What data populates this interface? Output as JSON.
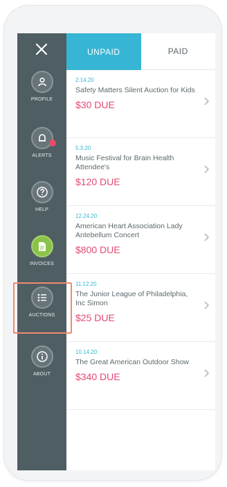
{
  "sidebar": {
    "close_glyph": "✕",
    "items": [
      {
        "label": "PROFILE",
        "icon": "person-icon"
      },
      {
        "label": "ALERTS",
        "icon": "bell-icon"
      },
      {
        "label": "HELP",
        "icon": "question-icon"
      },
      {
        "label": "INVOICES",
        "icon": "document-icon"
      },
      {
        "label": "AUCTIONS",
        "icon": "list-icon"
      },
      {
        "label": "ABOUT",
        "icon": "info-icon"
      }
    ]
  },
  "tabs": [
    {
      "label": "UNPAID",
      "active": true
    },
    {
      "label": "PAID",
      "active": false
    }
  ],
  "invoices": [
    {
      "date": "2.14.20",
      "title": "Safety Matters Silent Auction for Kids",
      "amount": "$30 DUE"
    },
    {
      "date": "5.3.20",
      "title": "Music Festival for Brain Health Attendee's",
      "amount": "$120 DUE"
    },
    {
      "date": "12.24.20",
      "title": "American Heart Association Lady Antebellum Concert",
      "amount": "$800 DUE"
    },
    {
      "date": "11.12.20",
      "title": "The Junior League of Philadelphia, Inc Simon",
      "amount": "$25 DUE"
    },
    {
      "date": "10.14.20",
      "title": "The Great American Outdoor Show",
      "amount": "$340 DUE"
    }
  ],
  "colors": {
    "sidebar_bg": "#4f5e62",
    "accent_blue": "#37b5d4",
    "amount_pink": "#e34a72",
    "active_green": "#8bc34a",
    "highlight_border": "#f08a6e"
  }
}
